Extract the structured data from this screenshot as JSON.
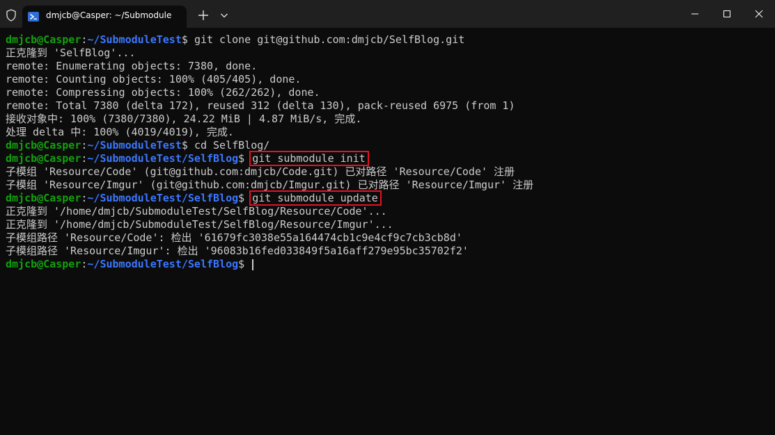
{
  "window": {
    "tab_title": "dmjcb@Casper: ~/Submodule",
    "icons": {
      "shield": "shield-icon",
      "tab": "powershell-icon",
      "new_tab": "plus-icon",
      "dropdown": "chevron-down-icon",
      "minimize": "minimize-icon",
      "maximize": "maximize-icon",
      "close": "close-icon"
    }
  },
  "colors": {
    "background": "#0c0c0c",
    "titlebar": "#202020",
    "prompt_user": "#13a10e",
    "prompt_path": "#3b78ff",
    "text": "#cccccc",
    "highlight_box": "#e81123"
  },
  "terminal": {
    "prompt_user": "dmjcb@Casper",
    "lines": [
      {
        "type": "prompt",
        "path": "~/SubmoduleTest",
        "command": "git clone git@github.com:dmjcb/SelfBlog.git"
      },
      {
        "type": "output",
        "text": "正克隆到 'SelfBlog'..."
      },
      {
        "type": "output",
        "text": "remote: Enumerating objects: 7380, done."
      },
      {
        "type": "output",
        "text": "remote: Counting objects: 100% (405/405), done."
      },
      {
        "type": "output",
        "text": "remote: Compressing objects: 100% (262/262), done."
      },
      {
        "type": "output",
        "text": "remote: Total 7380 (delta 172), reused 312 (delta 130), pack-reused 6975 (from 1)"
      },
      {
        "type": "output",
        "text": "接收对象中: 100% (7380/7380), 24.22 MiB | 4.87 MiB/s, 完成."
      },
      {
        "type": "output",
        "text": "处理 delta 中: 100% (4019/4019), 完成."
      },
      {
        "type": "prompt",
        "path": "~/SubmoduleTest",
        "command": "cd SelfBlog/"
      },
      {
        "type": "prompt",
        "path": "~/SubmoduleTest/SelfBlog",
        "command": "git submodule init",
        "highlight": true
      },
      {
        "type": "output",
        "text": "子模组 'Resource/Code' (git@github.com:dmjcb/Code.git) 已对路径 'Resource/Code' 注册"
      },
      {
        "type": "output",
        "text": "子模组 'Resource/Imgur' (git@github.com:dmjcb/Imgur.git) 已对路径 'Resource/Imgur' 注册"
      },
      {
        "type": "prompt",
        "path": "~/SubmoduleTest/SelfBlog",
        "command": "git submodule update",
        "highlight": true
      },
      {
        "type": "output",
        "text": "正克隆到 '/home/dmjcb/SubmoduleTest/SelfBlog/Resource/Code'..."
      },
      {
        "type": "output",
        "text": "正克隆到 '/home/dmjcb/SubmoduleTest/SelfBlog/Resource/Imgur'..."
      },
      {
        "type": "output",
        "text": "子模组路径 'Resource/Code': 检出 '61679fc3038e55a164474cb1c9e4cf9c7cb3cb8d'"
      },
      {
        "type": "output",
        "text": "子模组路径 'Resource/Imgur': 检出 '96083b16fed033849f5a16aff279e95bc35702f2'"
      },
      {
        "type": "prompt",
        "path": "~/SubmoduleTest/SelfBlog",
        "command": "",
        "cursor": true
      }
    ]
  }
}
